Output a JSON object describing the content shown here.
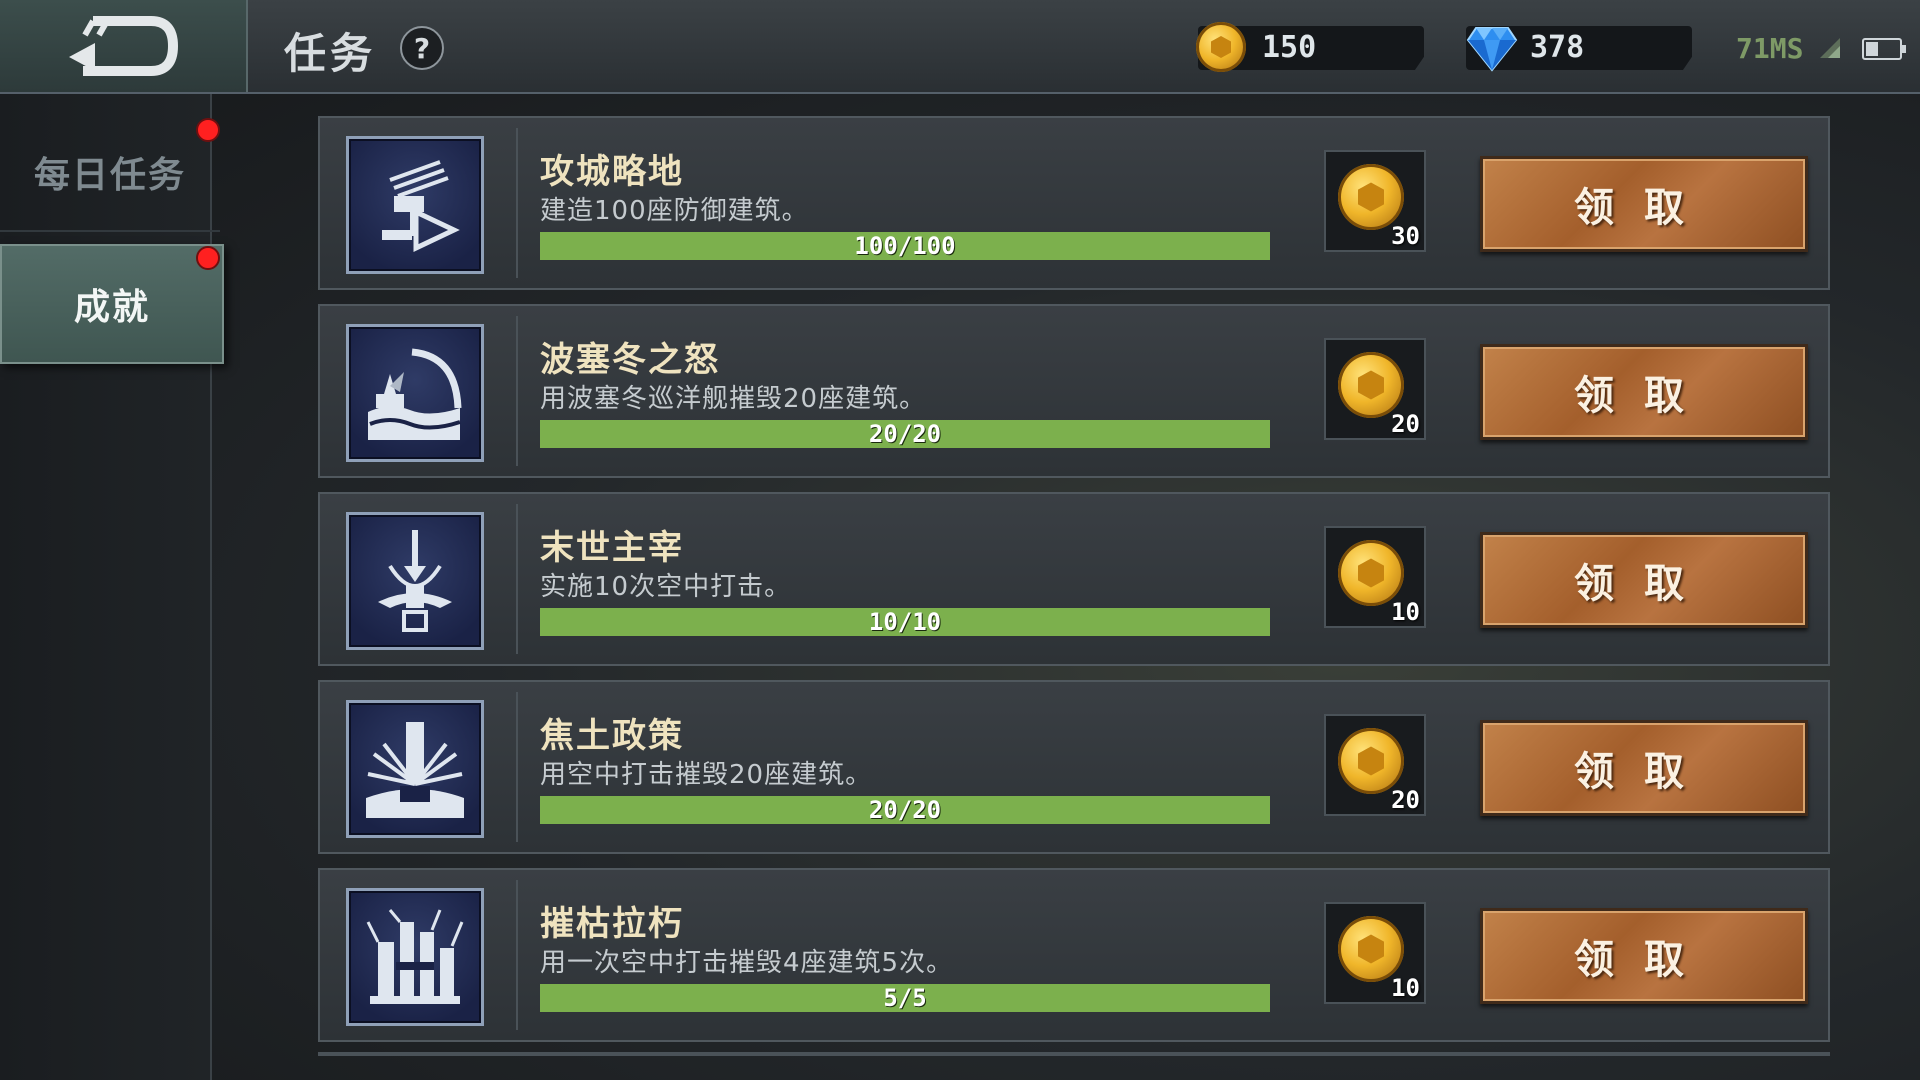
{
  "header": {
    "title": "任务",
    "help_label": "?",
    "gold": "150",
    "gems": "378",
    "ping": "71MS"
  },
  "sidebar": {
    "tabs": [
      {
        "label": "每日任务",
        "active": false,
        "has_notification": true
      },
      {
        "label": "成就",
        "active": true,
        "has_notification": true
      }
    ]
  },
  "achievements": [
    {
      "title": "攻城略地",
      "description": "建造100座防御建筑。",
      "progress_text": "100/100",
      "progress": 1.0,
      "reward": "30",
      "claim_label": "领取",
      "icon": "fortress-cannon-icon"
    },
    {
      "title": "波塞冬之怒",
      "description": "用波塞冬巡洋舰摧毁20座建筑。",
      "progress_text": "20/20",
      "progress": 1.0,
      "reward": "20",
      "claim_label": "领取",
      "icon": "poseidon-wave-icon"
    },
    {
      "title": "末世主宰",
      "description": "实施10次空中打击。",
      "progress_text": "10/10",
      "progress": 1.0,
      "reward": "10",
      "claim_label": "领取",
      "icon": "air-strike-icon"
    },
    {
      "title": "焦土政策",
      "description": "用空中打击摧毁20座建筑。",
      "progress_text": "20/20",
      "progress": 1.0,
      "reward": "20",
      "claim_label": "领取",
      "icon": "scorched-earth-icon"
    },
    {
      "title": "摧枯拉朽",
      "description": "用一次空中打击摧毁4座建筑5次。",
      "progress_text": "5/5",
      "progress": 1.0,
      "reward": "10",
      "claim_label": "领取",
      "icon": "destroyed-buildings-icon"
    }
  ],
  "colors": {
    "progress_fill": "#7cb04d",
    "claim_button": "#a45f2c",
    "notification_dot": "#ff2020"
  }
}
